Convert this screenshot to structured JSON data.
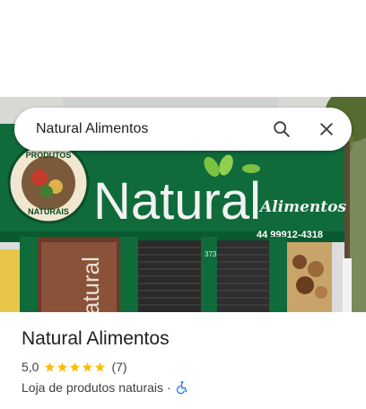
{
  "search": {
    "query": "Natural Alimentos"
  },
  "storefront_photo": {
    "sign_left_badge_line1": "PRODUTOS",
    "sign_left_badge_line2": "NATURAIS",
    "sign_main": "Natural",
    "sign_secondary": "Alimentos",
    "sign_phone": "44 99912-4318",
    "window_text": "Natural",
    "door_number": "373"
  },
  "place": {
    "name": "Natural Alimentos",
    "rating": "5,0",
    "stars": 5,
    "review_count": "(7)",
    "category": "Loja de produtos naturais",
    "separator": "·"
  },
  "colors": {
    "sign_green": "#0f6b3a",
    "star_yellow": "#fbbc04",
    "accessibility_blue": "#1a73e8"
  },
  "icons": [
    "search-icon",
    "close-icon",
    "star-icon",
    "wheelchair-icon"
  ]
}
